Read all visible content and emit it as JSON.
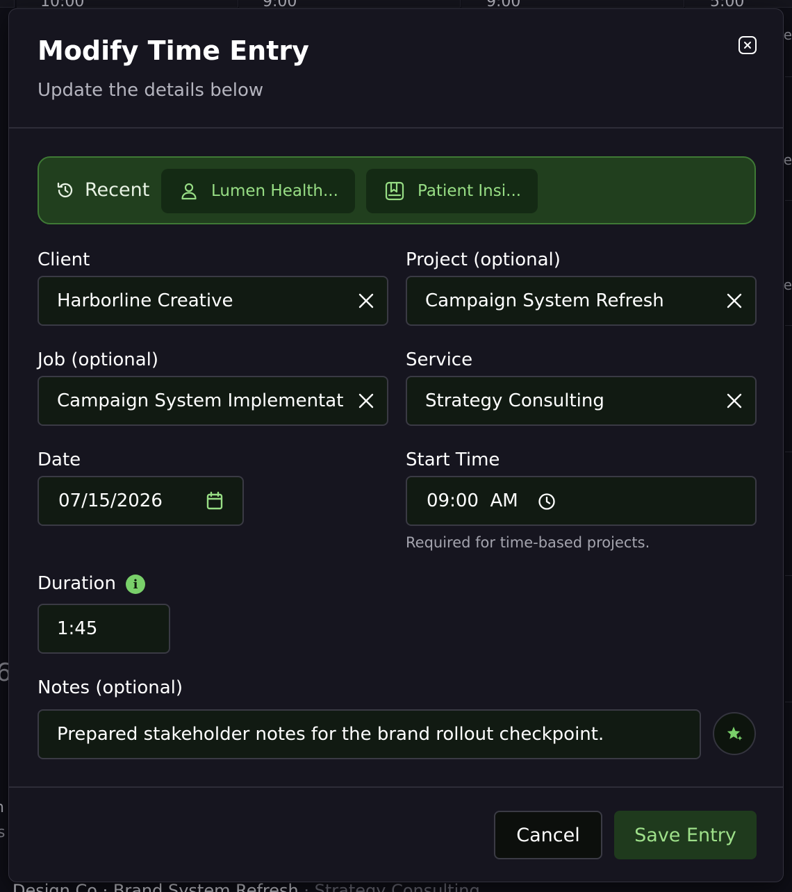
{
  "background": {
    "cells": [
      "10:00",
      "9:00",
      "9:00",
      "5:00"
    ],
    "side_glyphs": [
      "e",
      "e",
      "e"
    ],
    "left_glyph": "6",
    "left_fragments": [
      "n",
      "s"
    ],
    "footer": {
      "client": "Design Co",
      "sep1": "·",
      "project": "Brand System Refresh",
      "sep2": "·",
      "service": "Strategy Consulting"
    }
  },
  "modal": {
    "title": "Modify Time Entry",
    "subtitle": "Update the details below",
    "close_icon": "close-icon"
  },
  "recent": {
    "label": "Recent",
    "icon": "history-icon",
    "chips": [
      {
        "label": "Lumen Health...",
        "icon": "user-icon"
      },
      {
        "label": "Patient Insi...",
        "icon": "project-book-icon"
      }
    ]
  },
  "form": {
    "client": {
      "label": "Client",
      "value": "Harborline Creative"
    },
    "project": {
      "label": "Project (optional)",
      "value": "Campaign System Refresh"
    },
    "job": {
      "label": "Job (optional)",
      "value": "Campaign System Implementation"
    },
    "service": {
      "label": "Service",
      "value": "Strategy Consulting"
    },
    "date": {
      "label": "Date",
      "value": "07/15/2026"
    },
    "start_time": {
      "label": "Start Time",
      "value": "09:00  AM",
      "helper": "Required for time-based projects."
    },
    "duration": {
      "label": "Duration",
      "info": "i",
      "value": "1:45"
    },
    "notes": {
      "label": "Notes (optional)",
      "value": "Prepared stakeholder notes for the brand rollout checkpoint."
    }
  },
  "footer": {
    "cancel_label": "Cancel",
    "save_label": "Save Entry"
  },
  "colors": {
    "accent_green": "#98de85",
    "recent_bg": "#213f1e",
    "modal_bg": "#16151f"
  }
}
